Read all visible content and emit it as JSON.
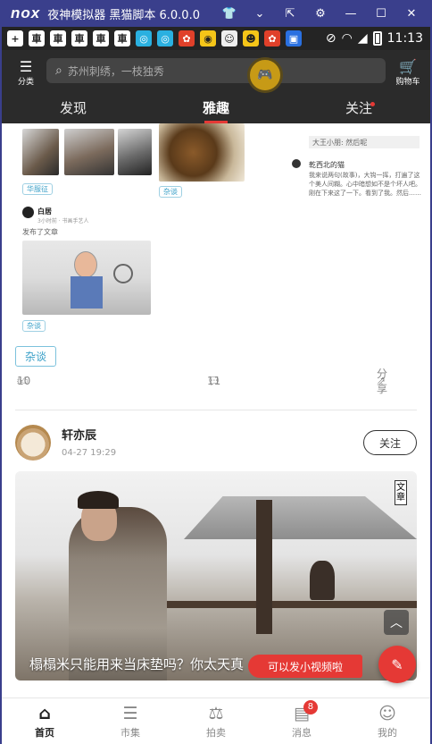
{
  "emulator": {
    "logo": "nox",
    "title": "夜神模拟器 黑猫脚本 6.0.0.0"
  },
  "status_bar": {
    "time": "11:13"
  },
  "header": {
    "category_label": "分类",
    "search_placeholder": "苏州刺绣，一枝独秀",
    "cart_label": "购物车"
  },
  "tabs": [
    {
      "label": "发现"
    },
    {
      "label": "雅趣"
    },
    {
      "label": "关注"
    }
  ],
  "post1": {
    "mini_tag1": "华服征",
    "mini_tag2": "杂谈",
    "mini_tag3": "杂谈",
    "mini_name": "白居",
    "mini_sub": "3小时前 · 书画手艺人",
    "mini_action": "发布了文章",
    "mini_comment_name": "乾西北的猫",
    "mini_comment_text": "我来说两句(故事)，大钩一挥，打遍了这个美人间糊。心中暗想如不是个坏人吧。刚在下来这了一下。看到了我。然后……",
    "mini_reply_hint": "大王小朋: 然后呢",
    "tag": "杂谈",
    "likes": "10",
    "comments": "11",
    "share": "分享"
  },
  "post2": {
    "author": "轩亦辰",
    "time": "04-27 19:29",
    "follow": "关注",
    "caption": "榻榻米只能用来当床垫吗？你太天真",
    "badge": "文章"
  },
  "video_tip": "可以发小视频啦",
  "bottom_nav": [
    {
      "label": "首页"
    },
    {
      "label": "市集"
    },
    {
      "label": "拍卖"
    },
    {
      "label": "消息",
      "badge": "8"
    },
    {
      "label": "我的"
    }
  ]
}
